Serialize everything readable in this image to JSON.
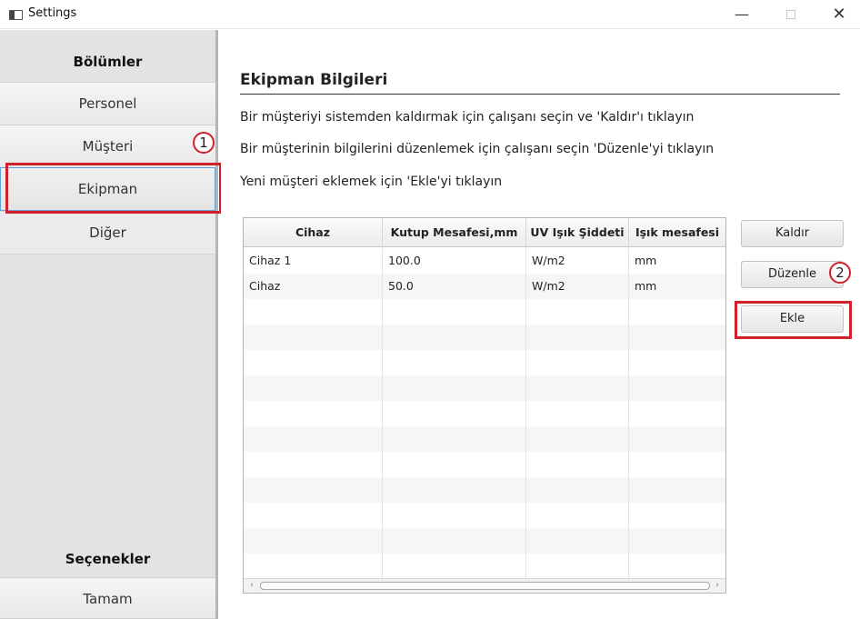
{
  "window": {
    "title": "Settings",
    "controls": {
      "minimize": "—",
      "close": "✕"
    }
  },
  "sidebar": {
    "sections_title": "Bölümler",
    "items": [
      {
        "label": "Personel"
      },
      {
        "label": "Müşteri"
      },
      {
        "label": "Ekipman",
        "selected": true
      },
      {
        "label": "Diğer"
      }
    ],
    "options_title": "Seçenekler",
    "ok_label": "Tamam"
  },
  "main": {
    "heading": "Ekipman Bilgileri",
    "instructions": [
      "Bir müşteriyi sistemden kaldırmak için çalışanı seçin ve 'Kaldır'ı tıklayın",
      "Bir müşterinin bilgilerini düzenlemek için çalışanı seçin 'Düzenle'yi tıklayın",
      "Yeni müşteri eklemek için 'Ekle'yi tıklayın"
    ],
    "table": {
      "columns": [
        "Cihaz",
        "Kutup Mesafesi,mm",
        "UV Işık Şiddeti",
        "Işık mesafesi"
      ],
      "rows": [
        [
          "Cihaz 1",
          "100.0",
          "W/m2",
          "mm"
        ],
        [
          "Cihaz",
          "50.0",
          "W/m2",
          "mm"
        ]
      ]
    },
    "buttons": {
      "remove": "Kaldır",
      "edit": "Düzenle",
      "add": "Ekle"
    }
  },
  "annotations": {
    "badge1": "1",
    "badge2": "2",
    "color": "#d0202a"
  }
}
